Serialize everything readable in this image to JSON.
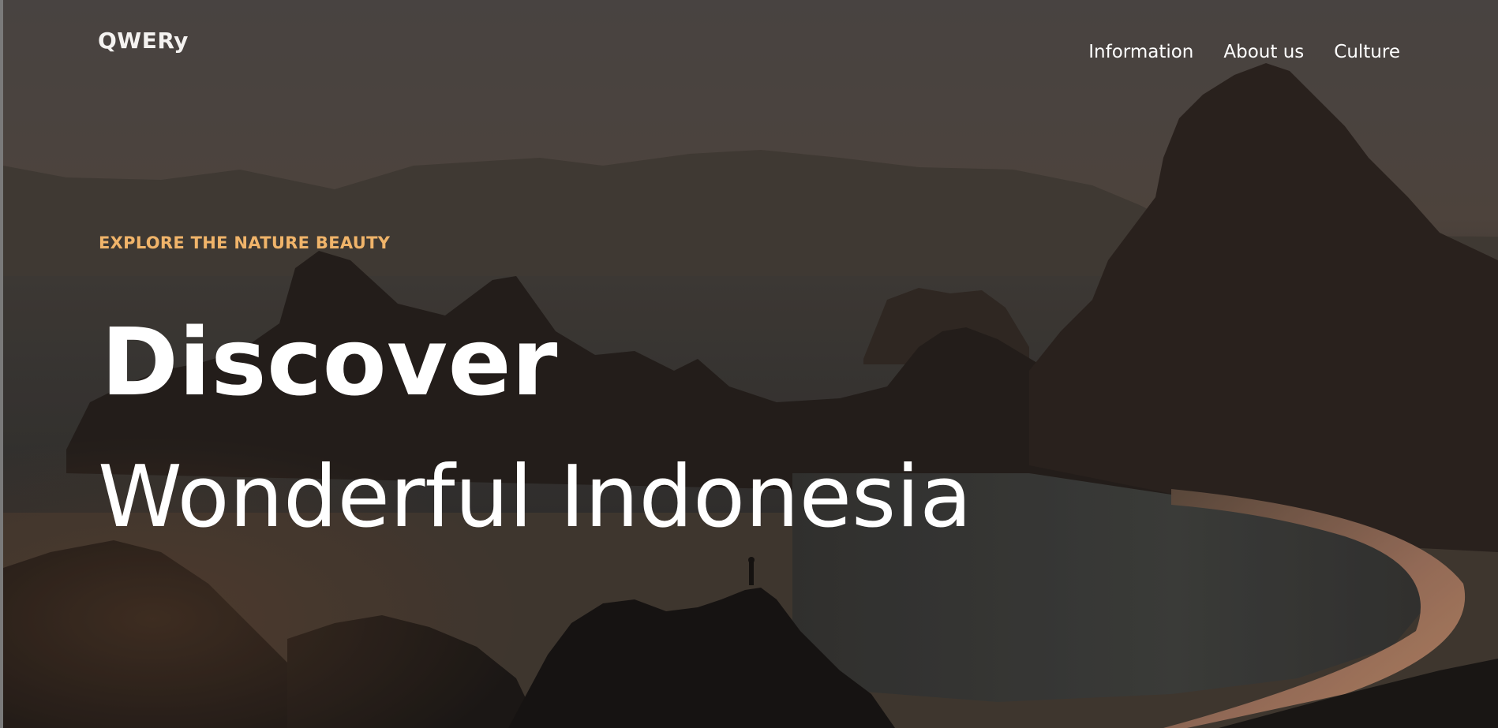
{
  "brand": {
    "logo_text": "QWERy"
  },
  "nav": {
    "items": [
      {
        "label": "Information"
      },
      {
        "label": "About us"
      },
      {
        "label": "Culture"
      }
    ]
  },
  "hero": {
    "eyebrow": "EXPLORE THE NATURE BEAUTY",
    "title_bold": "Discover",
    "title_light": "Wonderful Indonesia"
  },
  "colors": {
    "accent": "#f0b46a",
    "text": "#ffffff"
  }
}
